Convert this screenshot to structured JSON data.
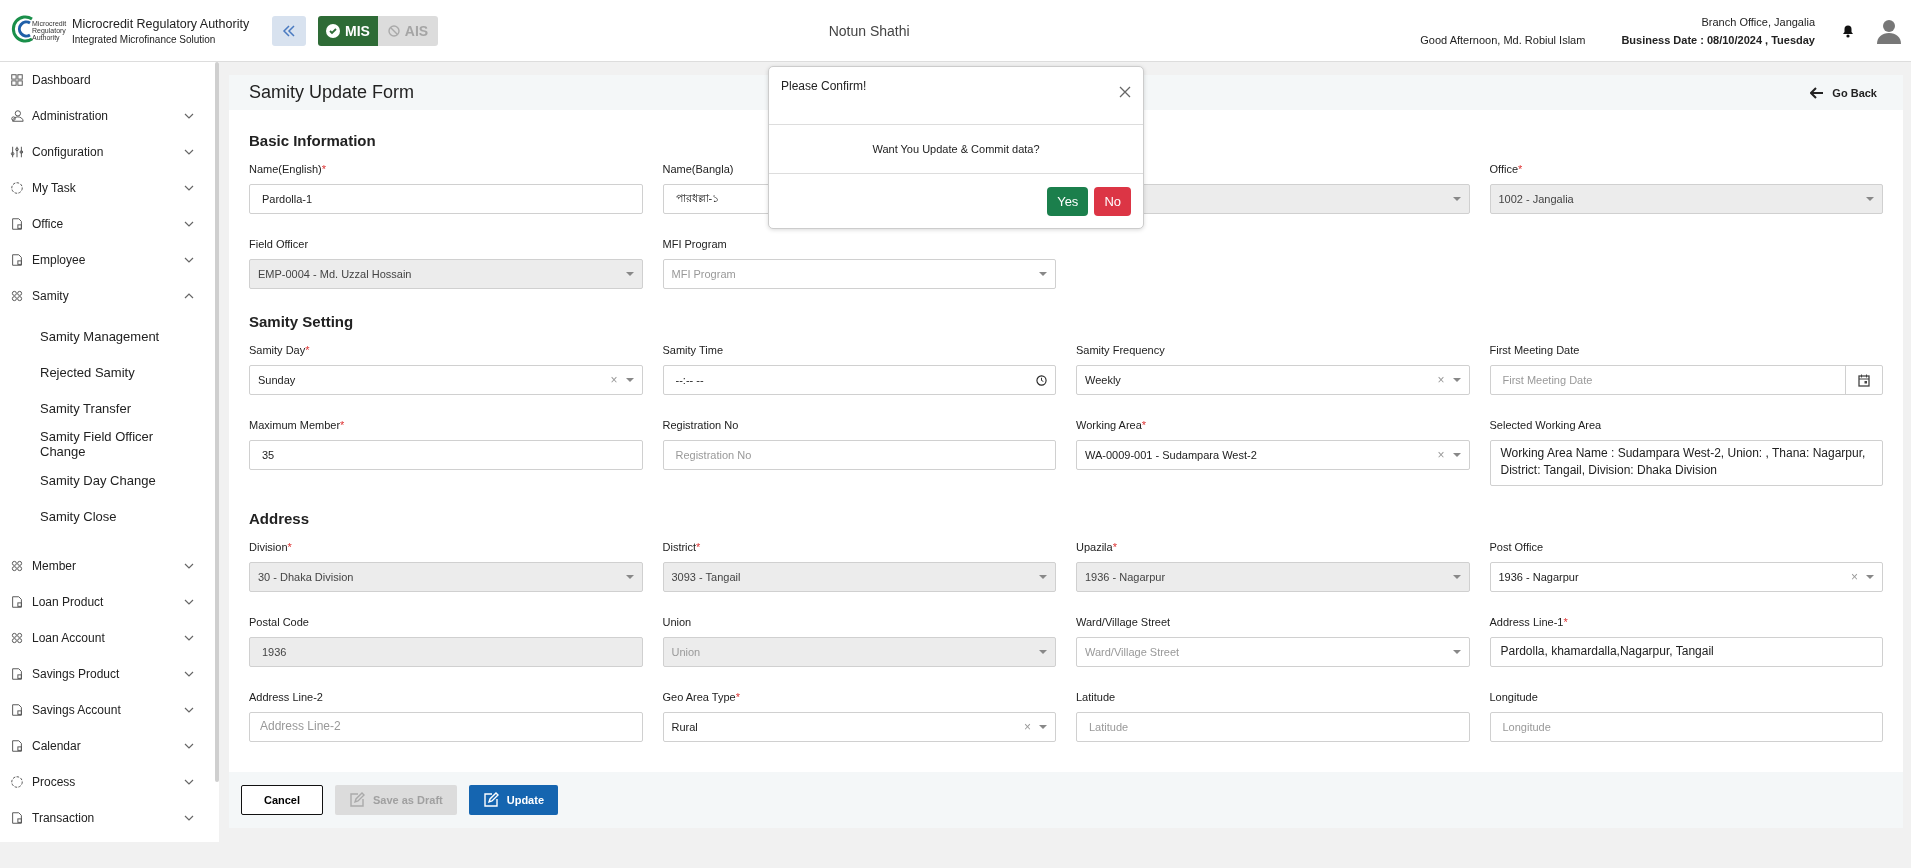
{
  "header": {
    "logo_text": "Microcredit Regulatory Authority",
    "title": "Microcredit Regulatory Authority",
    "subtitle": "Integrated Microfinance Solution",
    "modes": [
      {
        "label": "MIS",
        "selected": true
      },
      {
        "label": "AIS",
        "selected": false
      }
    ],
    "app_name": "Notun Shathi",
    "branch": "Branch Office, Jangalia",
    "greeting": "Good Afternoon, Md. Robiul Islam",
    "business_date": "**Business Date : 08/10/2024 , Tuesday**"
  },
  "sidebar": {
    "items": [
      {
        "label": "Dashboard",
        "kind": "link"
      },
      {
        "label": "Administration",
        "kind": "group",
        "expanded": false
      },
      {
        "label": "Configuration",
        "kind": "group",
        "expanded": false
      },
      {
        "label": "My Task",
        "kind": "group",
        "expanded": false
      },
      {
        "label": "Office",
        "kind": "group",
        "expanded": false
      },
      {
        "label": "Employee",
        "kind": "group",
        "expanded": false
      },
      {
        "label": "Samity",
        "kind": "group",
        "expanded": true,
        "children": [
          {
            "label": "Samity Management"
          },
          {
            "label": "Rejected Samity"
          },
          {
            "label": "Samity Transfer"
          },
          {
            "label": "Samity Field Officer Change"
          },
          {
            "label": "Samity Day Change"
          },
          {
            "label": "Samity Close"
          }
        ]
      },
      {
        "label": "Member",
        "kind": "group",
        "expanded": false
      },
      {
        "label": "Loan Product",
        "kind": "group",
        "expanded": false
      },
      {
        "label": "Loan Account",
        "kind": "group",
        "expanded": false
      },
      {
        "label": "Savings Product",
        "kind": "group",
        "expanded": false
      },
      {
        "label": "Savings Account",
        "kind": "group",
        "expanded": false
      },
      {
        "label": "Calendar",
        "kind": "group",
        "expanded": false
      },
      {
        "label": "Process",
        "kind": "group",
        "expanded": false
      },
      {
        "label": "Transaction",
        "kind": "group",
        "expanded": false
      }
    ]
  },
  "page": {
    "title": "Samity Update Form",
    "back": "Go Back"
  },
  "sections": [
    {
      "title": "Basic Information",
      "rows": [
        [
          {
            "label": "Name(English)",
            "required_mark": "*",
            "kind": "text",
            "value": "Pardolla-1"
          },
          {
            "label": "Name(Bangla)",
            "kind": "text",
            "value": "পারধল্লা-১"
          },
          {
            "kind": "select",
            "disabled": true
          },
          {
            "label": "Office",
            "required_mark": "*",
            "kind": "select",
            "value": "1002 - Jangalia",
            "disabled": true
          }
        ],
        [
          {
            "label": "Field Officer",
            "kind": "select",
            "value": "EMP-0004 - Md. Uzzal Hossain",
            "disabled": true
          },
          {
            "label": "MFI Program",
            "kind": "select",
            "placeholder": "MFI Program",
            "disabled": false
          }
        ]
      ]
    },
    {
      "title": "Samity Setting",
      "rows": [
        [
          {
            "label": "Samity Day",
            "required_mark": "*",
            "kind": "select",
            "value": "Sunday",
            "clear": "×",
            "disabled": false
          },
          {
            "label": "Samity Time",
            "kind": "time",
            "value": "--:-- --"
          },
          {
            "label": "Samity Frequency",
            "kind": "select",
            "value": "Weekly",
            "clear": "×",
            "disabled": false
          },
          {
            "label": "First Meeting Date",
            "kind": "date",
            "placeholder": "First Meeting Date"
          }
        ],
        [
          {
            "label": "Maximum Member",
            "required_mark": "*",
            "kind": "text",
            "value": "35"
          },
          {
            "label": "Registration No",
            "kind": "text",
            "placeholder": "Registration No"
          },
          {
            "label": "Working Area",
            "required_mark": "*",
            "kind": "select",
            "value": "WA-0009-001 - Sudampara West-2",
            "clear": "×",
            "disabled": false
          },
          {
            "label": "Selected Working Area",
            "kind": "textarea",
            "value": "Working Area Name : Sudampara West-2, Union: , Thana:  Nagarpur, District: Tangail, Division: Dhaka Division"
          }
        ]
      ]
    },
    {
      "title": "Address",
      "rows": [
        [
          {
            "label": "Division",
            "required_mark": "*",
            "kind": "select",
            "value": "30 - Dhaka Division",
            "disabled": true
          },
          {
            "label": "District",
            "required_mark": "*",
            "kind": "select",
            "value": "3093 - Tangail",
            "disabled": true
          },
          {
            "label": "Upazila",
            "required_mark": "*",
            "kind": "select",
            "value": "1936 - Nagarpur",
            "disabled": true
          },
          {
            "label": "Post Office",
            "kind": "select",
            "value": "1936 - Nagarpur",
            "clear": "×",
            "disabled": false
          }
        ],
        [
          {
            "label": "Postal Code",
            "kind": "text",
            "value": "1936",
            "disabled": true
          },
          {
            "label": "Union",
            "kind": "select",
            "placeholder": "Union",
            "disabled": true
          },
          {
            "label": "Ward/Village Street",
            "kind": "select",
            "placeholder": "Ward/Village Street",
            "disabled": false
          },
          {
            "label": "Address Line-1",
            "required_mark": "*",
            "kind": "textarea",
            "value": "Pardolla, khamardalla,Nagarpur, Tangail"
          }
        ],
        [
          {
            "label": "Address Line-2",
            "kind": "textarea",
            "placeholder": "Address Line-2"
          },
          {
            "label": "Geo Area Type",
            "required_mark": "*",
            "kind": "select",
            "value": "Rural",
            "clear": "×",
            "disabled": false
          },
          {
            "label": "Latitude",
            "kind": "text",
            "placeholder": "Latitude"
          },
          {
            "label": "Longitude",
            "kind": "text",
            "placeholder": "Longitude"
          }
        ]
      ]
    }
  ],
  "actions": [
    {
      "label": "Cancel",
      "kind": "outline",
      "disabled": false
    },
    {
      "label": "Save as Draft",
      "kind": "draft",
      "disabled": true
    },
    {
      "label": "Update",
      "kind": "primary",
      "disabled": false
    }
  ],
  "modal": {
    "title": "Please Confirm!",
    "message": "Want You Update & Commit data?",
    "buttons": [
      {
        "label": "Yes",
        "kind": "confirm"
      },
      {
        "label": "No",
        "kind": "cancel"
      }
    ]
  }
}
